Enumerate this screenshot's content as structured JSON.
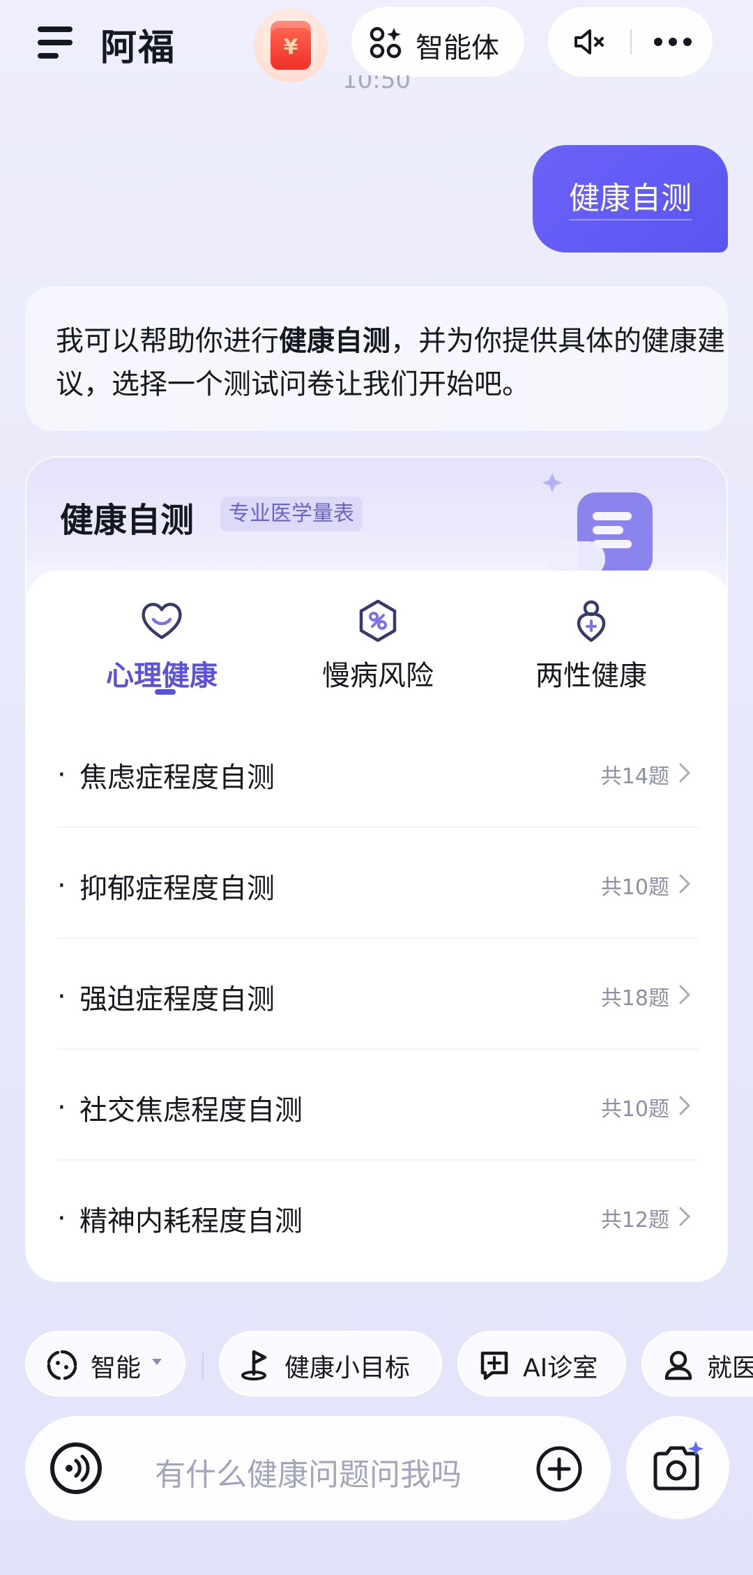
{
  "header": {
    "title": "阿福",
    "redpacket_symbol": "¥",
    "agent_label": "智能体",
    "timestamp": "10:50"
  },
  "chat": {
    "user_message": "健康自测",
    "bot_message_part1": "我可以帮助你进行",
    "bot_message_bold": "健康自测",
    "bot_message_part2": "，并为你提供具体的健康建议，选择一个测试问卷让我们开始吧。"
  },
  "card": {
    "title": "健康自测",
    "badge": "专业医学量表",
    "tabs": [
      {
        "label": "心理健康",
        "icon": "heart-smile-icon",
        "active": true
      },
      {
        "label": "慢病风险",
        "icon": "hexagon-pill-icon",
        "active": false
      },
      {
        "label": "两性健康",
        "icon": "gender-icon",
        "active": false
      }
    ],
    "items": [
      {
        "dot": "·",
        "label": "焦虑症程度自测",
        "count": "共14题"
      },
      {
        "dot": "·",
        "label": "抑郁症程度自测",
        "count": "共10题"
      },
      {
        "dot": "·",
        "label": "强迫症程度自测",
        "count": "共18题"
      },
      {
        "dot": "·",
        "label": "社交焦虑程度自测",
        "count": "共10题"
      },
      {
        "dot": "·",
        "label": "精神内耗程度自测",
        "count": "共12题"
      }
    ]
  },
  "chips": [
    {
      "label": "智能",
      "icon": "smart-mode-icon"
    },
    {
      "label": "健康小目标",
      "icon": "goal-flag-icon"
    },
    {
      "label": "AI诊室",
      "icon": "chat-plus-icon"
    },
    {
      "label": "就医",
      "icon": "doctor-icon"
    }
  ],
  "input": {
    "placeholder": "有什么健康问题问我吗"
  },
  "colors": {
    "accent": "#5a53d8",
    "user_bubble": "#5f59f4",
    "background": "#e8e9fb",
    "muted_text": "#8b8fa6"
  }
}
